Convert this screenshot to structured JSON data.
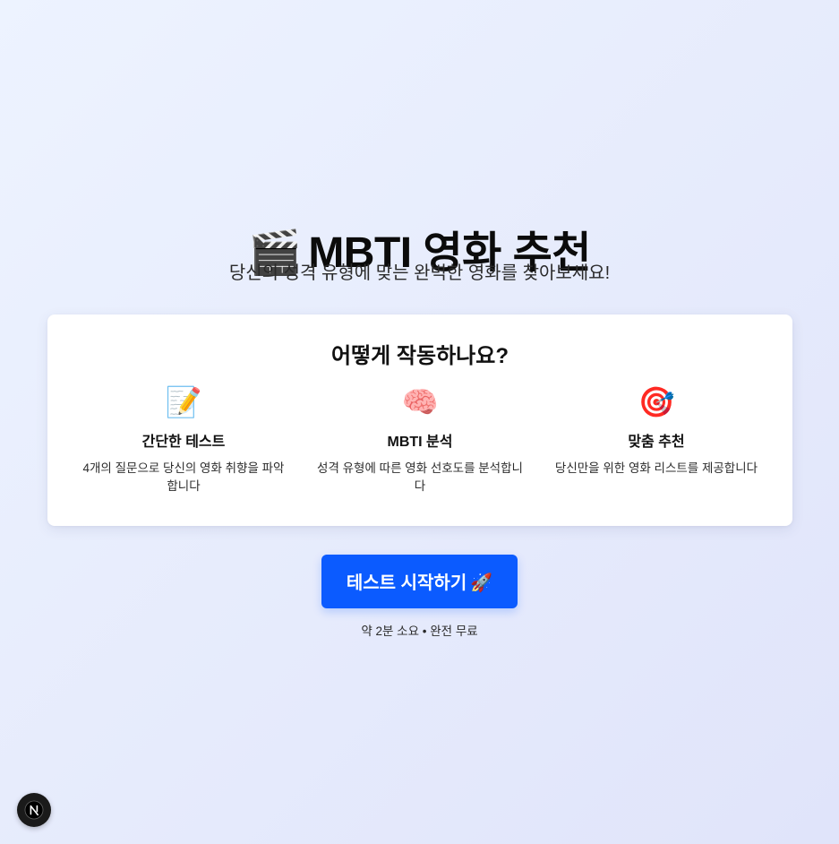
{
  "header": {
    "title_icon": "🎬",
    "title_icon_name": "clapper-board-icon",
    "title": "MBTI 영화 추천",
    "subtitle": "당신의 성격 유형에 맞는 완벽한 영화를 찾아보세요!"
  },
  "how_it_works": {
    "title": "어떻게 작동하나요?",
    "features": [
      {
        "icon": "📝",
        "icon_name": "memo-icon",
        "title": "간단한 테스트",
        "description": "4개의 질문으로 당신의 영화 취향을 파악합니다"
      },
      {
        "icon": "🧠",
        "icon_name": "brain-icon",
        "title": "MBTI 분석",
        "description": "성격 유형에 따른 영화 선호도를 분석합니다"
      },
      {
        "icon": "🎯",
        "icon_name": "target-icon",
        "title": "맞춤 추천",
        "description": "당신만을 위한 영화 리스트를 제공합니다"
      }
    ]
  },
  "cta": {
    "label": "테스트 시작하기",
    "icon": "🚀",
    "icon_name": "rocket-icon",
    "note": "약 2분 소요 • 완전 무료"
  },
  "dev_badge": {
    "letter": "N",
    "icon_name": "nextjs-logo-icon"
  },
  "colors": {
    "accent": "#0b5bff",
    "card_background": "#ffffff",
    "page_gradient_start": "#edf3ff",
    "page_gradient_end": "#e0e4fa",
    "badge_background": "#1a1a1a"
  }
}
